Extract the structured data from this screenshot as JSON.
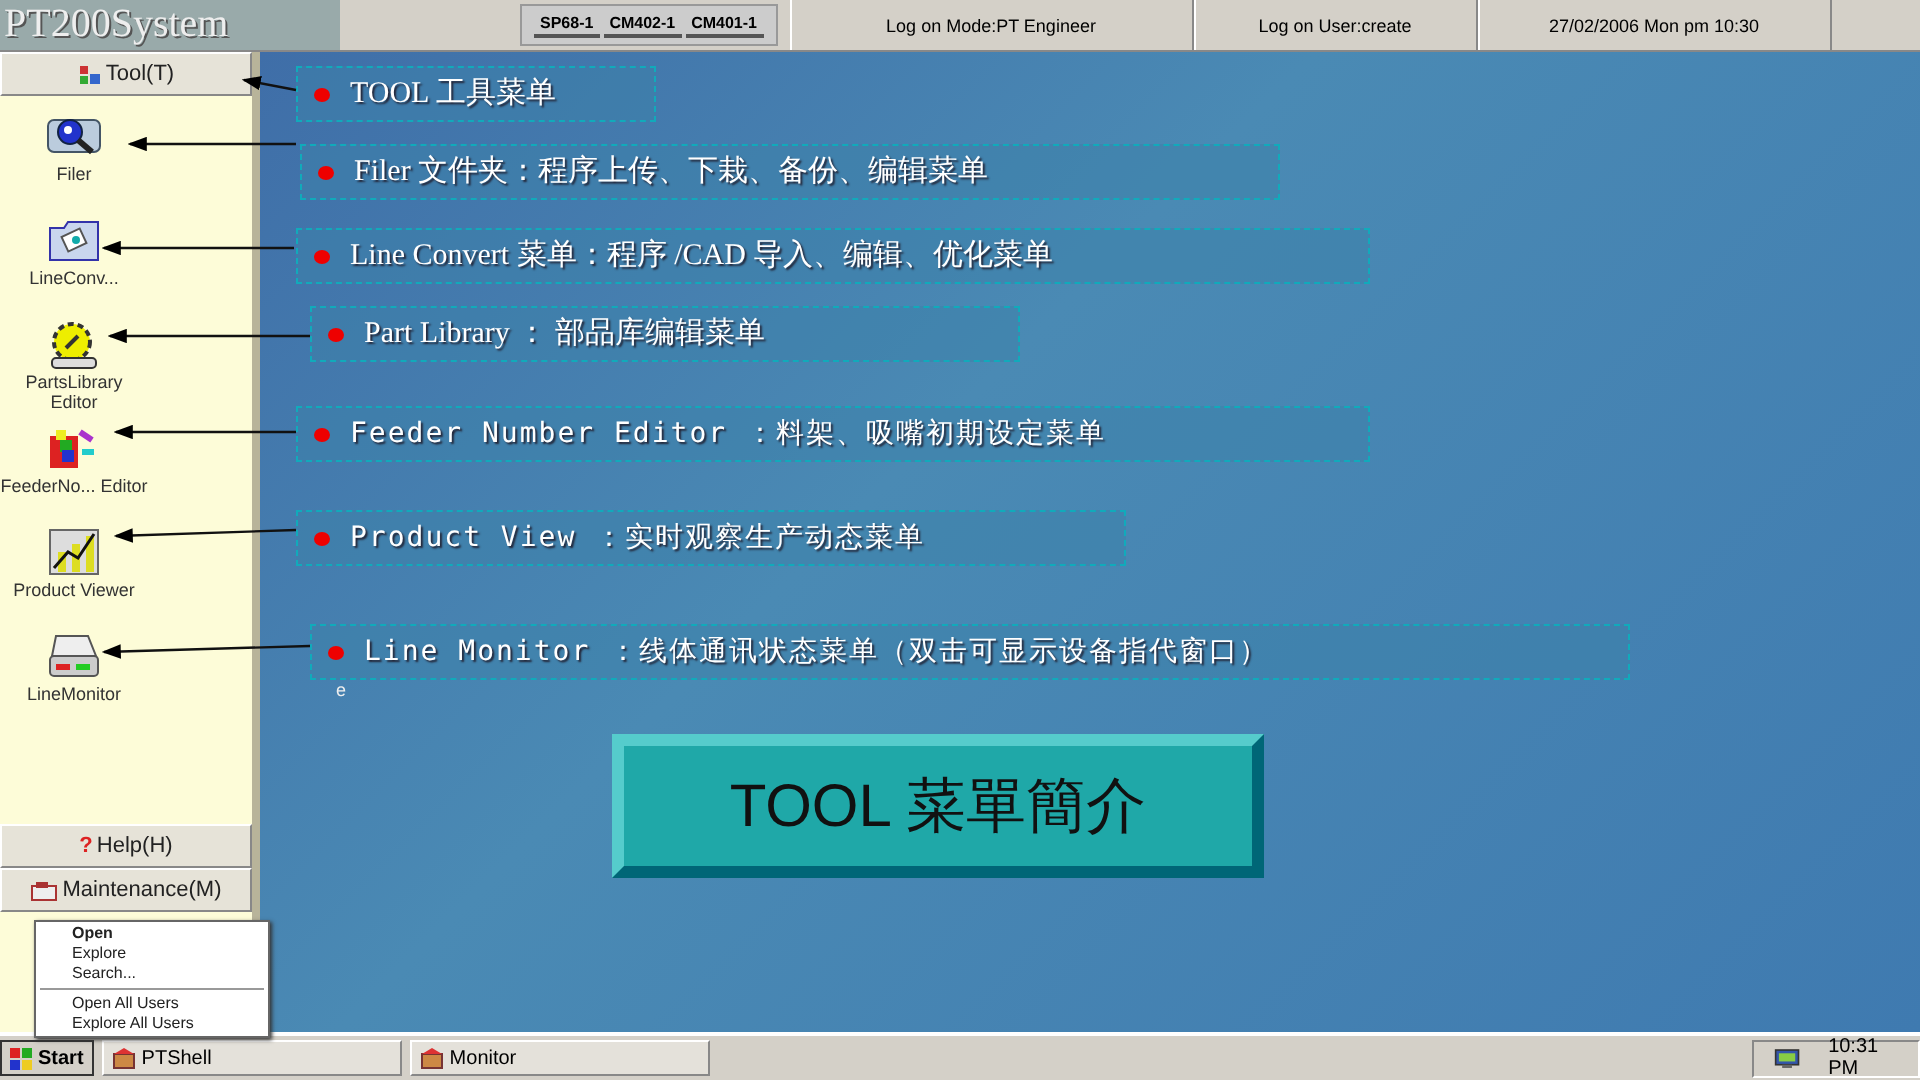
{
  "header": {
    "logo": "PT200System",
    "machines": [
      "SP68-1",
      "CM402-1",
      "CM401-1"
    ],
    "logon_mode": "Log on Mode:PT Engineer",
    "logon_user": "Log on User:create",
    "datetime": "27/02/2006 Mon pm 10:30"
  },
  "sidebar": {
    "tool_button": "Tool(T)",
    "tools": [
      {
        "kind": "magnifier",
        "label": "Filer"
      },
      {
        "kind": "folder",
        "label": "LineConv..."
      },
      {
        "kind": "gear",
        "label": "PartsLibrary Editor"
      },
      {
        "kind": "blocks",
        "label": "FeederNo... Editor"
      },
      {
        "kind": "chart",
        "label": "Product Viewer"
      },
      {
        "kind": "printer",
        "label": "LineMonitor"
      }
    ],
    "help_icon": "?",
    "help_button": "Help(H)",
    "maintenance_button": "Maintenance(M)"
  },
  "context_menu": {
    "groups": [
      [
        {
          "label": "Open",
          "kind": "default"
        },
        {
          "label": "Explore",
          "kind": "item"
        },
        {
          "label": "Search...",
          "kind": "item"
        }
      ],
      [
        {
          "label": "Open All Users",
          "kind": "item"
        },
        {
          "label": "Explore All Users",
          "kind": "item"
        }
      ]
    ]
  },
  "callouts": [
    {
      "text": "TOOL 工具菜单",
      "kind": "serif"
    },
    {
      "text": "Filer 文件夹：程序上传、下栽、备份、编辑菜单",
      "kind": "serif"
    },
    {
      "text": "Line Convert 菜单：程序 /CAD 导入、编辑、优化菜单",
      "kind": "serif"
    },
    {
      "text": "Part Library ： 部品库编辑菜单",
      "kind": "serif"
    },
    {
      "text": "Feeder Number Editor ：料架、吸嘴初期设定菜单",
      "kind": "spaced"
    },
    {
      "text": "Product View ：实时观察生产动态菜单",
      "kind": "spaced"
    },
    {
      "text": "Line Monitor ：线体通讯状态菜单（双击可显示设备指代窗口）",
      "kind": "spaced"
    }
  ],
  "note_mark": "e",
  "slide_title": "TOOL 菜單簡介",
  "taskbar": {
    "start": "Start",
    "tasks": [
      "PTShell",
      "Monitor"
    ],
    "clock": "10:31 PM"
  }
}
